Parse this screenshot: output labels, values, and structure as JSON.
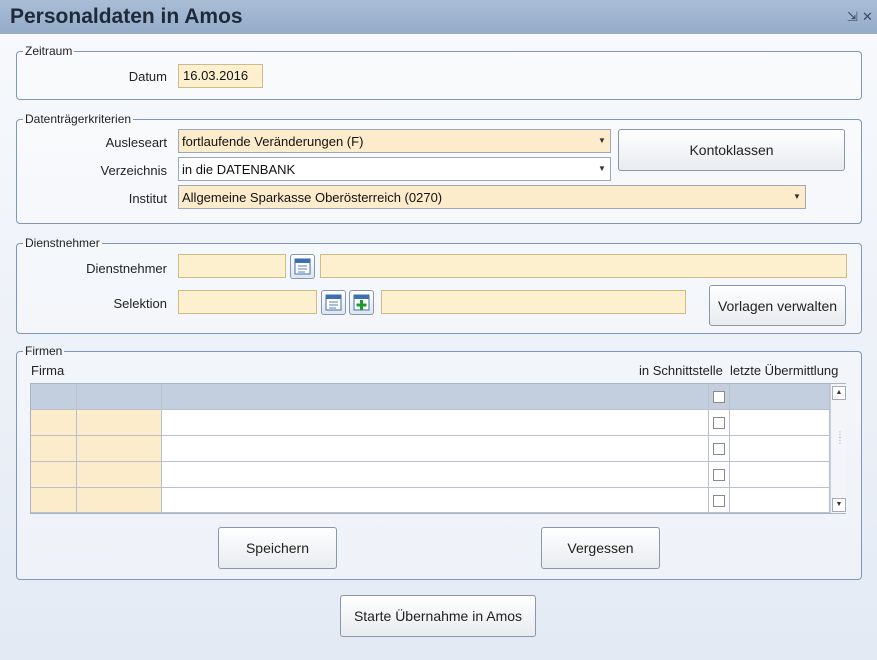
{
  "window": {
    "title": "Personaldaten in Amos",
    "minimize_glyph": "⇲",
    "close_glyph": "✕"
  },
  "zeitraum": {
    "legend": "Zeitraum",
    "datum_label": "Datum",
    "datum_value": "16.03.2016"
  },
  "datentraeger": {
    "legend": "Datenträgerkriterien",
    "ausleseart_label": "Ausleseart",
    "ausleseart_value": "fortlaufende Veränderungen (F)",
    "verzeichnis_label": "Verzeichnis",
    "verzeichnis_value": "in die DATENBANK",
    "institut_label": "Institut",
    "institut_value": "Allgemeine Sparkasse Oberösterreich (0270)",
    "kontoklassen_button": "Kontoklassen"
  },
  "dienstnehmer": {
    "legend": "Dienstnehmer",
    "dienstnehmer_label": "Dienstnehmer",
    "dienstnehmer_value": "",
    "dienstnehmer_name": "",
    "selektion_label": "Selektion",
    "selektion_value": "",
    "selektion_name": "",
    "vorlagen_button": "Vorlagen verwalten"
  },
  "firmen": {
    "legend": "Firmen",
    "col_firma": "Firma",
    "col_schnittstelle": "in Schnittstelle",
    "col_uebermittlung": "letzte Übermittlung",
    "rows": [
      {
        "firma": "",
        "nr": "",
        "name": "",
        "checked": false,
        "uebermittlung": ""
      },
      {
        "firma": "",
        "nr": "",
        "name": "",
        "checked": false,
        "uebermittlung": ""
      },
      {
        "firma": "",
        "nr": "",
        "name": "",
        "checked": false,
        "uebermittlung": ""
      },
      {
        "firma": "",
        "nr": "",
        "name": "",
        "checked": false,
        "uebermittlung": ""
      }
    ],
    "speichern_button": "Speichern",
    "vergessen_button": "Vergessen"
  },
  "footer": {
    "start_button": "Starte Übernahme in Amos"
  },
  "colors": {
    "titlebar": "#94abc9",
    "border": "#7d97bd",
    "yellow_field": "#fdeccb",
    "grid_header": "#c3cfdf"
  }
}
